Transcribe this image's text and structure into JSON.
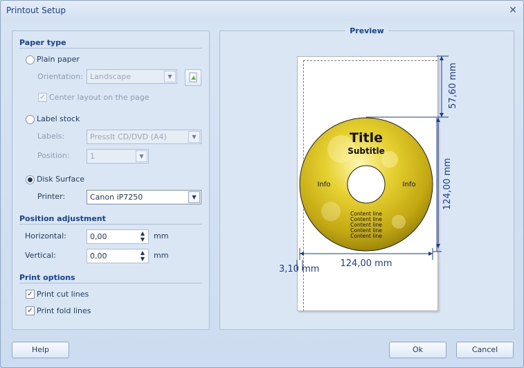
{
  "window": {
    "title": "Printout Setup"
  },
  "paper_type": {
    "heading": "Paper type",
    "plain_paper": {
      "label": "Plain paper",
      "selected": false
    },
    "orientation": {
      "label": "Orientation:",
      "value": "Landscape"
    },
    "center_layout": {
      "label": "Center layout on the page",
      "checked": true
    },
    "label_stock": {
      "label": "Label stock",
      "selected": false
    },
    "labels": {
      "label": "Labels:",
      "value": "PressIt CD/DVD (A4)"
    },
    "position": {
      "label": "Position:",
      "value": "1"
    },
    "disk_surface": {
      "label": "Disk Surface",
      "selected": true
    },
    "printer": {
      "label": "Printer:",
      "value": "Canon iP7250"
    }
  },
  "position_adjustment": {
    "heading": "Position adjustment",
    "horizontal": {
      "label": "Horizontal:",
      "value": "0,00",
      "unit": "mm"
    },
    "vertical": {
      "label": "Vertical:",
      "value": "0,00",
      "unit": "mm"
    }
  },
  "print_options": {
    "heading": "Print options",
    "cut_lines": {
      "label": "Print cut lines",
      "checked": true
    },
    "fold_lines": {
      "label": "Print fold lines",
      "checked": true
    }
  },
  "preview": {
    "heading": "Preview",
    "disc": {
      "title": "Title",
      "subtitle": "Subtitle",
      "info_left": "Info",
      "info_right": "Info",
      "content_lines": [
        "Content line",
        "Content line",
        "Content line",
        "Content line",
        "Content line"
      ]
    },
    "dimensions": {
      "top_offset": "57,60 mm",
      "height": "124,00 mm",
      "width": "124,00 mm",
      "left_offset": "3,10 mm"
    }
  },
  "buttons": {
    "help": "Help",
    "ok": "Ok",
    "cancel": "Cancel"
  },
  "colors": {
    "title_text": "#15428b",
    "disc_gold": "#e2c91b",
    "dimension_line": "#1f3c8c"
  }
}
